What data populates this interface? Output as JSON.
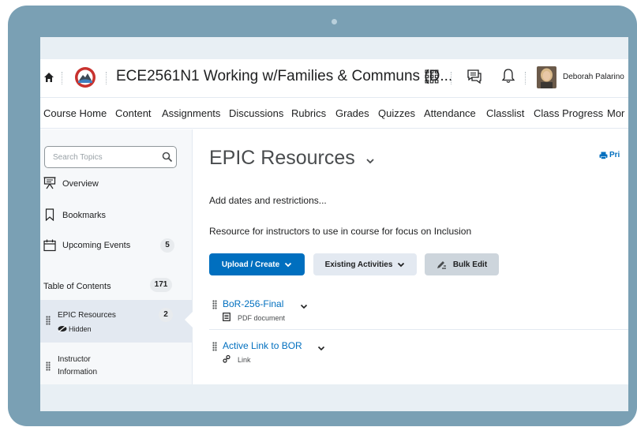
{
  "header": {
    "course_title": "ECE2561N1 Working w/Families & Communs (D...",
    "user_name": "Deborah Palarino"
  },
  "nav": {
    "items": [
      "Course Home",
      "Content",
      "Assignments",
      "Discussions",
      "Rubrics",
      "Grades",
      "Quizzes",
      "Attendance",
      "Classlist",
      "Class Progress",
      "Mor"
    ]
  },
  "sidebar": {
    "search_placeholder": "Search Topics",
    "overview": "Overview",
    "bookmarks": "Bookmarks",
    "upcoming_events": "Upcoming Events",
    "upcoming_count": "5",
    "toc_label": "Table of Contents",
    "toc_count": "171",
    "modules": [
      {
        "title": "EPIC Resources",
        "count": "2",
        "status": "Hidden"
      },
      {
        "title": "Instructor Information"
      }
    ]
  },
  "main": {
    "title": "EPIC Resources",
    "print_label": "Pri",
    "dates_link": "Add dates and restrictions...",
    "description": "Resource for instructors to use in course for focus on Inclusion",
    "upload_button": "Upload / Create",
    "existing_button": "Existing Activities",
    "bulk_edit_button": "Bulk Edit",
    "items": [
      {
        "title": "BoR-256-Final",
        "type": "PDF document"
      },
      {
        "title": "Active Link to BOR",
        "type": "Link"
      }
    ]
  },
  "colors": {
    "frame": "#7aa0b4",
    "accent": "#006fbf",
    "sidebar_bg": "#f6f8fa",
    "selected_bg": "#e3e9f1"
  }
}
